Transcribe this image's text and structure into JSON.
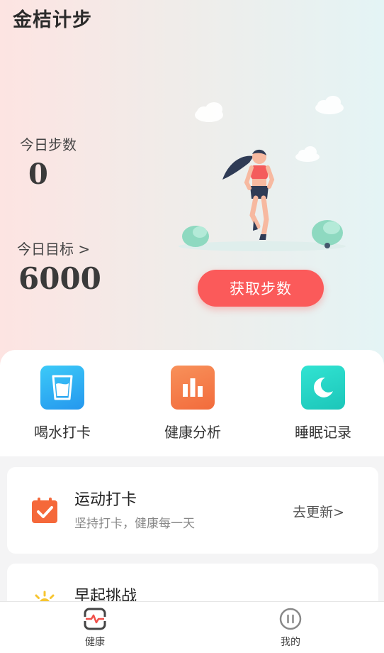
{
  "app_title": "金桔计步",
  "steps": {
    "label": "今日步数",
    "value": "0"
  },
  "goal": {
    "label": "今日目标 >",
    "value": "6000"
  },
  "get_steps_button": "获取步数",
  "quick_actions": [
    {
      "label": "喝水打卡",
      "icon": "water-cup-icon",
      "color": "#27a9f0"
    },
    {
      "label": "健康分析",
      "icon": "bar-chart-icon",
      "color": "#f47b45"
    },
    {
      "label": "睡眠记录",
      "icon": "moon-icon",
      "color": "#24d2c4"
    }
  ],
  "cards": [
    {
      "title": "运动打卡",
      "subtitle": "坚持打卡，健康每一天",
      "action": "去更新>",
      "icon": "calendar-check-icon",
      "color": "#f5683a"
    },
    {
      "title": "早起挑战",
      "icon": "sun-icon",
      "color": "#f7c530"
    }
  ],
  "tabs": [
    {
      "label": "健康",
      "icon": "heart-monitor-icon",
      "color": "#f0504a"
    },
    {
      "label": "我的",
      "icon": "pause-circle-icon",
      "color": "#777777"
    }
  ]
}
